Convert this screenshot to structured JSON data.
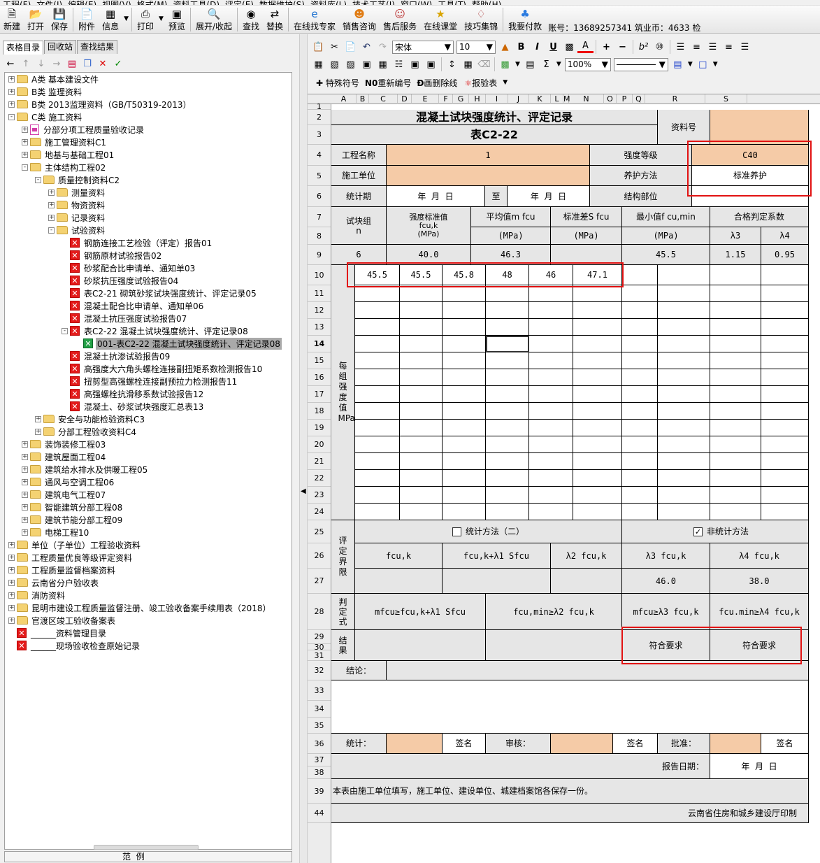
{
  "menu": [
    "工程(F)",
    "文件(I)",
    "编辑(E)",
    "视图(V)",
    "格式(M)",
    "资料工具(D)",
    "评定(E)",
    "数据维护(S)",
    "资料库(L)",
    "技术工艺(J)",
    "窗口(W)",
    "工具(T)",
    "帮助(H)"
  ],
  "toolbar": {
    "buttons": [
      {
        "label": "新建",
        "icon": "new-doc-icon"
      },
      {
        "label": "打开",
        "icon": "folder-open-icon"
      },
      {
        "label": "保存",
        "icon": "save-icon"
      },
      {
        "label": "附件",
        "icon": "attachment-icon"
      },
      {
        "label": "信息",
        "icon": "info-icon"
      },
      {
        "label": "打印",
        "icon": "print-icon"
      },
      {
        "label": "预览",
        "icon": "preview-icon"
      },
      {
        "label": "展开/收起",
        "icon": "expand-icon"
      },
      {
        "label": "查找",
        "icon": "binoculars-icon"
      },
      {
        "label": "替换",
        "icon": "replace-icon"
      },
      {
        "label": "在线找专家",
        "icon": "ie-icon"
      },
      {
        "label": "销售咨询",
        "icon": "sales-icon"
      },
      {
        "label": "售后服务",
        "icon": "service-icon"
      },
      {
        "label": "在线课堂",
        "icon": "classroom-icon"
      },
      {
        "label": "技巧集锦",
        "icon": "tips-icon"
      },
      {
        "label": "我要付款",
        "icon": "pay-icon"
      }
    ],
    "account": "账号：13689257341 筑业币：4633",
    "account_more": "检"
  },
  "left": {
    "tabs": [
      "表格目录",
      "回收站",
      "查找结果"
    ],
    "range_label": "范  例",
    "tree": [
      {
        "d": 0,
        "t": "f",
        "label": "A类 基本建设文件",
        "e": "+"
      },
      {
        "d": 0,
        "t": "f",
        "label": "B类 监理资料",
        "e": "+"
      },
      {
        "d": 0,
        "t": "f",
        "label": "B类 2013监理资料（GB/T50319-2013）",
        "e": "+"
      },
      {
        "d": 0,
        "t": "fo",
        "label": "C类 施工资料",
        "e": "-"
      },
      {
        "d": 1,
        "t": "p",
        "label": "分部分项工程质量验收记录",
        "e": "+"
      },
      {
        "d": 1,
        "t": "f",
        "label": "施工管理资料C1",
        "e": "+"
      },
      {
        "d": 1,
        "t": "f",
        "label": "地基与基础工程01",
        "e": "+"
      },
      {
        "d": 1,
        "t": "fo",
        "label": "主体结构工程02",
        "e": "-"
      },
      {
        "d": 2,
        "t": "fo",
        "label": "质量控制资料C2",
        "e": "-"
      },
      {
        "d": 3,
        "t": "f",
        "label": "测量资料",
        "e": "+"
      },
      {
        "d": 3,
        "t": "f",
        "label": "物资资料",
        "e": "+"
      },
      {
        "d": 3,
        "t": "f",
        "label": "记录资料",
        "e": "+"
      },
      {
        "d": 3,
        "t": "fo",
        "label": "试验资料",
        "e": "-"
      },
      {
        "d": 4,
        "t": "x",
        "label": "钢筋连接工艺检验（评定）报告01"
      },
      {
        "d": 4,
        "t": "x",
        "label": "钢筋原材试验报告02"
      },
      {
        "d": 4,
        "t": "x",
        "label": "砂浆配合比申请单、通知单03"
      },
      {
        "d": 4,
        "t": "x",
        "label": "砂浆抗压强度试验报告04"
      },
      {
        "d": 4,
        "t": "x",
        "label": "表C2-21 砌筑砂浆试块强度统计、评定记录05"
      },
      {
        "d": 4,
        "t": "x",
        "label": "混凝土配合比申请单、通知单06"
      },
      {
        "d": 4,
        "t": "x",
        "label": "混凝土抗压强度试验报告07"
      },
      {
        "d": 4,
        "t": "x",
        "label": "表C2-22 混凝土试块强度统计、评定记录08",
        "e": "-"
      },
      {
        "d": 5,
        "t": "g",
        "label": "001-表C2-22 混凝土试块强度统计、评定记录08",
        "sel": true
      },
      {
        "d": 4,
        "t": "x",
        "label": "混凝土抗渗试验报告09"
      },
      {
        "d": 4,
        "t": "x",
        "label": "高强度大六角头螺栓连接副扭矩系数检测报告10"
      },
      {
        "d": 4,
        "t": "x",
        "label": "扭剪型高强螺栓连接副预拉力检测报告11"
      },
      {
        "d": 4,
        "t": "x",
        "label": "高强螺栓抗滑移系数试验报告12"
      },
      {
        "d": 4,
        "t": "x",
        "label": "混凝土、砂浆试块强度汇总表13"
      },
      {
        "d": 2,
        "t": "f",
        "label": "安全与功能检验资料C3",
        "e": "+"
      },
      {
        "d": 2,
        "t": "f",
        "label": "分部工程验收资料C4",
        "e": "+"
      },
      {
        "d": 1,
        "t": "f",
        "label": "装饰装修工程03",
        "e": "+"
      },
      {
        "d": 1,
        "t": "f",
        "label": "建筑屋面工程04",
        "e": "+"
      },
      {
        "d": 1,
        "t": "f",
        "label": "建筑给水排水及供暖工程05",
        "e": "+"
      },
      {
        "d": 1,
        "t": "f",
        "label": "通风与空调工程06",
        "e": "+"
      },
      {
        "d": 1,
        "t": "f",
        "label": "建筑电气工程07",
        "e": "+"
      },
      {
        "d": 1,
        "t": "f",
        "label": "智能建筑分部工程08",
        "e": "+"
      },
      {
        "d": 1,
        "t": "f",
        "label": "建筑节能分部工程09",
        "e": "+"
      },
      {
        "d": 1,
        "t": "f",
        "label": "电梯工程10",
        "e": "+"
      },
      {
        "d": 0,
        "t": "f",
        "label": "单位（子单位）工程验收资料",
        "e": "+"
      },
      {
        "d": 0,
        "t": "f",
        "label": "工程质量优良等级评定资料",
        "e": "+"
      },
      {
        "d": 0,
        "t": "f",
        "label": "工程质量监督档案资料",
        "e": "+"
      },
      {
        "d": 0,
        "t": "f",
        "label": "云南省分户验收表",
        "e": "+"
      },
      {
        "d": 0,
        "t": "f",
        "label": "消防资料",
        "e": "+"
      },
      {
        "d": 0,
        "t": "f",
        "label": "昆明市建设工程质量监督注册、竣工验收备案手续用表（2018）",
        "e": "+"
      },
      {
        "d": 0,
        "t": "f",
        "label": "官渡区竣工验收备案表",
        "e": "+"
      },
      {
        "d": 0,
        "t": "x",
        "label": "______资料管理目录"
      },
      {
        "d": 0,
        "t": "x",
        "label": "______现场验收检查原始记录"
      }
    ]
  },
  "format": {
    "font_name": "宋体",
    "font_size": "10",
    "zoom": "100%",
    "special_symbol": "特殊符号",
    "renumber": "重新编号",
    "strike": "画删除线",
    "report": "报验表"
  },
  "columns": [
    "A",
    "B",
    "C",
    "D",
    "E",
    "F",
    "G",
    "H",
    "I",
    "J",
    "K",
    "L",
    "M",
    "N",
    "O",
    "P",
    "Q",
    "R",
    "S"
  ],
  "rows": [
    "1",
    "2",
    "3",
    "4",
    "5",
    "6",
    "7",
    "8",
    "9",
    "10",
    "11",
    "12",
    "13",
    "14",
    "15",
    "16",
    "17",
    "18",
    "19",
    "20",
    "21",
    "22",
    "23",
    "24",
    "25",
    "26",
    "27",
    "28",
    "29",
    "30",
    "31",
    "32",
    "33",
    "34",
    "35",
    "36",
    "37",
    "38",
    "39",
    "44"
  ],
  "form": {
    "title": "混凝土试块强度统计、评定记录",
    "code": "表C2-22",
    "doc_no_label": "资料号",
    "project_label": "工程名称",
    "project_value": "1",
    "grade_label": "强度等级",
    "grade_value": "C40",
    "unit_label": "施工单位",
    "curing_label": "养护方法",
    "curing_value": "标准养护",
    "period_label": "统计期",
    "period_from": "年  月  日",
    "period_to_label": "至",
    "period_to": "年  月  日",
    "part_label": "结构部位",
    "h_groups": "试块组\nn",
    "h_std": "强度标准值\nfcu,k\n(MPa)",
    "h_avg": "平均值m fcu",
    "h_avg_unit": "(MPa)",
    "h_sd": "标准差S fcu",
    "h_sd_unit": "(MPa)",
    "h_min": "最小值f cu,min",
    "h_min_unit": "(MPa)",
    "h_coef": "合格判定系数",
    "h_l3": "λ3",
    "h_l4": "λ4",
    "v_groups": "6",
    "v_std": "40.0",
    "v_avg": "46.3",
    "v_min": "45.5",
    "v_l3": "1.15",
    "v_l4": "0.95",
    "each_group_label": "每组强度值MPa",
    "values": [
      "45.5",
      "45.5",
      "45.8",
      "48",
      "46",
      "47.1"
    ],
    "stat_method": "统计方法（二）",
    "nonstat_method": "非统计方法",
    "eval_label": "评定界限",
    "lim_1": "fcu,k",
    "lim_2": "fcu,k+λ1 Sfcu",
    "lim_3": "λ2 fcu,k",
    "lim_4": "λ3 fcu,k",
    "lim_5": "λ4 fcu,k",
    "lim_v4": "46.0",
    "lim_v5": "38.0",
    "judge_label": "判定式",
    "j1": "mfcu≥fcu,k+λ1 Sfcu",
    "j2": "fcu,min≥λ2 fcu,k",
    "j3": "mfcu≥λ3 fcu,k",
    "j4": "fcu.min≥λ4 fcu,k",
    "result_label": "结果",
    "r3": "符合要求",
    "r4": "符合要求",
    "conclusion": "结论：",
    "stat_sign_label": "统计：",
    "sign": "签名",
    "review_label": "审核：",
    "approve_label": "批准：",
    "report_date_label": "报告日期：",
    "report_date": "年  月  日",
    "footnote": "本表由施工单位填写，施工单位、建设单位、城建档案馆各保存一份。",
    "printer": "云南省住房和城乡建设厅印制"
  },
  "colors": {
    "highlight": "#e21212",
    "input_fill": "#f5cba7",
    "label_fill": "#e6e6e6"
  }
}
